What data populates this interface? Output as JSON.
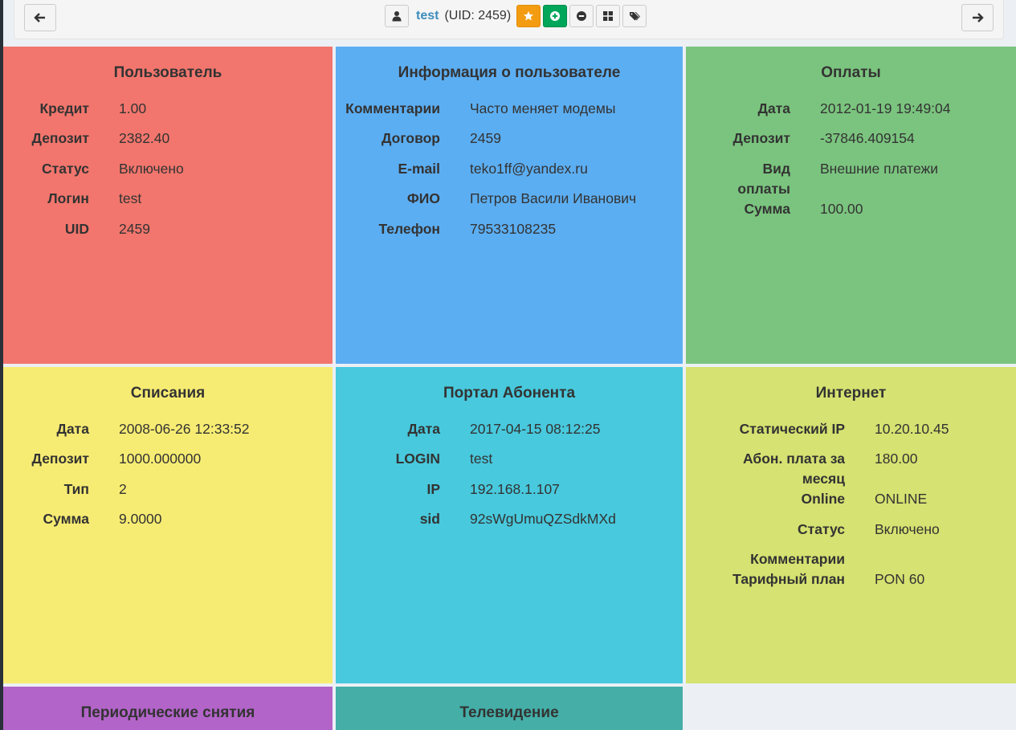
{
  "header": {
    "user_name": "test",
    "uid_text": "(UID: 2459)"
  },
  "panels": {
    "user": {
      "title": "Пользователь",
      "rows": [
        {
          "label": "Кредит",
          "value": "1.00"
        },
        {
          "label": "Депозит",
          "value": "2382.40"
        },
        {
          "label": "Статус",
          "value": "Включено"
        },
        {
          "label": "Логин",
          "value": "test"
        },
        {
          "label": "UID",
          "value": "2459"
        }
      ]
    },
    "info": {
      "title": "Информация о пользователе",
      "rows": [
        {
          "label": "Комментарии",
          "value": "Часто меняет модемы"
        },
        {
          "label": "Договор",
          "value": "2459"
        },
        {
          "label": "E-mail",
          "value": "teko1ff@yandex.ru"
        },
        {
          "label": "ФИО",
          "value": "Петров Васили Иванович"
        },
        {
          "label": "Телефон",
          "value": "79533108235"
        }
      ]
    },
    "payments": {
      "title": "Оплаты",
      "rows": [
        {
          "label": "Дата",
          "value": "2012-01-19 19:49:04"
        },
        {
          "label": "Депозит",
          "value": "-37846.409154"
        },
        {
          "label": "Вид оплаты",
          "value": "Внешние платежи"
        },
        {
          "label": "Сумма",
          "value": "100.00"
        }
      ]
    },
    "fees": {
      "title": "Списания",
      "rows": [
        {
          "label": "Дата",
          "value": "2008-06-26 12:33:52"
        },
        {
          "label": "Депозит",
          "value": "1000.000000"
        },
        {
          "label": "Тип",
          "value": "2"
        },
        {
          "label": "Сумма",
          "value": "9.0000"
        }
      ]
    },
    "portal": {
      "title": "Портал Абонента",
      "rows": [
        {
          "label": "Дата",
          "value": "2017-04-15 08:12:25"
        },
        {
          "label": "LOGIN",
          "value": "test"
        },
        {
          "label": "IP",
          "value": "192.168.1.107"
        },
        {
          "label": "sid",
          "value": "92sWgUmuQZSdkMXd"
        }
      ]
    },
    "internet": {
      "title": "Интернет",
      "rows": [
        {
          "label": "Статический IP",
          "value": "10.20.10.45"
        },
        {
          "label": "Абон. плата за месяц",
          "value": "180.00"
        },
        {
          "label": "Online",
          "value": "ONLINE"
        },
        {
          "label": "Статус",
          "value": "Включено"
        },
        {
          "label": "Комментарии",
          "value": ""
        },
        {
          "label": "Тарифный план",
          "value": "PON 60"
        }
      ]
    },
    "periodic": {
      "title": "Периодические снятия"
    },
    "tv": {
      "title": "Телевидение"
    }
  },
  "icons": {
    "back": "arrow-left-icon",
    "forward": "arrow-right-icon",
    "user": "user-icon",
    "star": "star-icon",
    "add": "plus-circle-icon",
    "remove": "minus-circle-icon",
    "grid": "grid-icon",
    "tags": "tags-icon"
  },
  "colors": {
    "user": "#f2766d",
    "info": "#5caef2",
    "payments": "#7bc47f",
    "fees": "#f7ec73",
    "portal": "#48c9dd",
    "internet": "#d6e271",
    "periodic": "#b264c8",
    "tv": "#44aea7",
    "link": "#3c8dbc"
  }
}
